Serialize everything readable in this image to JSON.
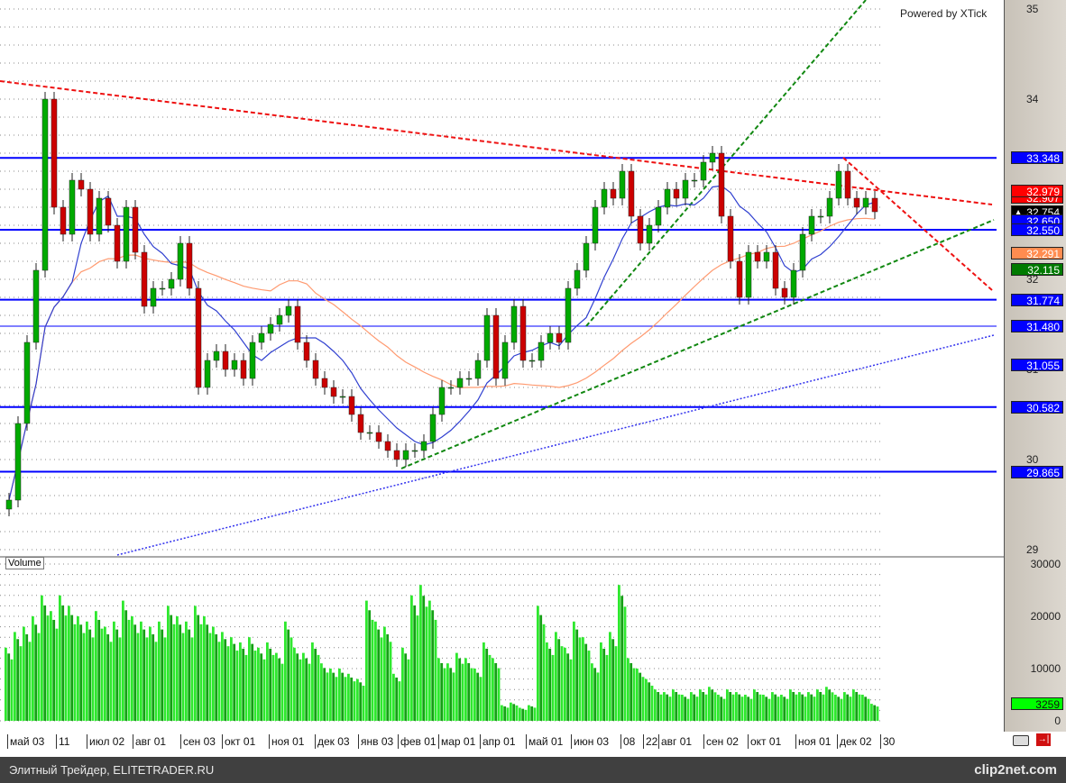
{
  "chart_data": {
    "type": "candlestick",
    "title": "",
    "watermark": "Powered by XTick",
    "price_axis": {
      "ticks": [
        "35",
        "34",
        "32",
        "31",
        "30",
        "29"
      ],
      "range": [
        29,
        35
      ]
    },
    "volume_axis": {
      "label": "Volume",
      "ticks": [
        "30000",
        "20000",
        "10000",
        "0"
      ],
      "range": [
        0,
        30000
      ]
    },
    "x_labels": [
      "май 03",
      "11",
      "июл 02",
      "авг 01",
      "сен 03",
      "окт 01",
      "ноя 01",
      "дек 03",
      "янв 03",
      "фев 01",
      "мар 01",
      "апр 01",
      "май 01",
      "июн 03",
      "08",
      "22",
      "авг 01",
      "сен 02",
      "окт 01",
      "ноя 01",
      "дек 02",
      "30"
    ],
    "closes": [
      29.55,
      30.4,
      31.3,
      32.1,
      34.0,
      32.8,
      32.5,
      33.1,
      33.0,
      32.5,
      32.9,
      32.6,
      32.2,
      32.8,
      32.3,
      31.7,
      31.9,
      31.9,
      32.0,
      32.4,
      31.9,
      30.8,
      31.1,
      31.2,
      31.0,
      31.1,
      30.9,
      31.3,
      31.4,
      31.5,
      31.6,
      31.7,
      31.3,
      31.1,
      30.9,
      30.8,
      30.7,
      30.7,
      30.5,
      30.3,
      30.3,
      30.2,
      30.1,
      30.0,
      30.1,
      30.1,
      30.2,
      30.5,
      30.8,
      30.8,
      30.9,
      30.9,
      31.1,
      31.6,
      30.9,
      31.3,
      31.7,
      31.1,
      31.1,
      31.3,
      31.4,
      31.3,
      31.9,
      32.1,
      32.4,
      32.8,
      33.0,
      32.9,
      33.2,
      32.7,
      32.4,
      32.6,
      32.8,
      33.0,
      32.9,
      33.1,
      33.1,
      33.3,
      33.4,
      32.7,
      32.2,
      31.8,
      32.3,
      32.2,
      32.3,
      31.9,
      31.8,
      32.1,
      32.5,
      32.7,
      32.7,
      32.9,
      33.2,
      32.9,
      32.8,
      32.9,
      32.75
    ],
    "volumes": [
      14000,
      17000,
      18000,
      20000,
      24000,
      21000,
      24000,
      22000,
      20000,
      19000,
      21000,
      18000,
      19000,
      23000,
      20000,
      19000,
      18000,
      19000,
      22000,
      20000,
      19000,
      22000,
      20000,
      18000,
      17000,
      16000,
      15000,
      16000,
      14000,
      15000,
      13000,
      19000,
      14000,
      13000,
      15000,
      11000,
      10000,
      10000,
      9000,
      8000,
      23000,
      19000,
      18000,
      9000,
      14000,
      24000,
      26000,
      23000,
      12000,
      11000,
      13000,
      12000,
      10000,
      15000,
      12000,
      3000,
      3500,
      2500,
      3000,
      22000,
      15000,
      17000,
      14000,
      19000,
      16000,
      11000,
      15000,
      17000,
      26000,
      12000,
      10000,
      8000,
      6000,
      5500,
      6000,
      5000,
      5500,
      6000,
      6500,
      5000,
      6000,
      5500,
      5000,
      6000,
      5000,
      5500,
      5000,
      6000,
      5500,
      5500,
      6000,
      6500,
      5000,
      5500,
      6000,
      5000,
      3259
    ],
    "levels": [
      {
        "value": 33.348,
        "label": "33.348",
        "color": "#0000ff"
      },
      {
        "value": 32.55,
        "label": "32.550",
        "color": "#0000ff"
      },
      {
        "value": 31.774,
        "label": "31.774",
        "color": "#0000ff"
      },
      {
        "value": 31.48,
        "label": "31.480",
        "color": "#0000ff"
      },
      {
        "value": 30.582,
        "label": "30.582",
        "color": "#0000ff"
      },
      {
        "value": 29.865,
        "label": "29.865",
        "color": "#0000ff"
      }
    ],
    "tags": [
      {
        "value": 33.348,
        "label": "33.348",
        "bg": "#0000ff",
        "fg": "#ffffff"
      },
      {
        "value": 32.907,
        "label": "32.907",
        "bg": "#ff0000",
        "fg": "#ffffff"
      },
      {
        "value": 32.979,
        "label": "32.979",
        "bg": "#ff0000",
        "fg": "#ffffff"
      },
      {
        "value": 32.754,
        "label": "▲ 32.754",
        "bg": "#000000",
        "fg": "#ffffff"
      },
      {
        "value": 32.65,
        "label": "32.650",
        "bg": "#0000ff",
        "fg": "#ffffff"
      },
      {
        "value": 32.55,
        "label": "32.550",
        "bg": "#0000ff",
        "fg": "#ffffff"
      },
      {
        "value": 32.291,
        "label": "32.291",
        "bg": "#ff8c50",
        "fg": "#ffffff"
      },
      {
        "value": 32.115,
        "label": "32.115",
        "bg": "#007a00",
        "fg": "#ffffff"
      },
      {
        "value": 31.774,
        "label": "31.774",
        "bg": "#0000ff",
        "fg": "#ffffff"
      },
      {
        "value": 31.48,
        "label": "31.480",
        "bg": "#0000ff",
        "fg": "#ffffff"
      },
      {
        "value": 31.055,
        "label": "31.055",
        "bg": "#0000ff",
        "fg": "#ffffff"
      },
      {
        "value": 30.582,
        "label": "30.582",
        "bg": "#0000ff",
        "fg": "#ffffff"
      },
      {
        "value": 29.865,
        "label": "29.865",
        "bg": "#0000ff",
        "fg": "#ffffff"
      }
    ],
    "volume_tag": {
      "label": "3259",
      "bg": "#00ff00"
    },
    "colors": {
      "up": "#00aa00",
      "down": "#cc0000",
      "ma_fast": "#3040d0",
      "ma_slow": "#ff9a70",
      "volume": "#22cc22"
    }
  },
  "footer": {
    "left": "Элитный Трейдер, ELITETRADER.RU",
    "right": "clip2net.com"
  }
}
